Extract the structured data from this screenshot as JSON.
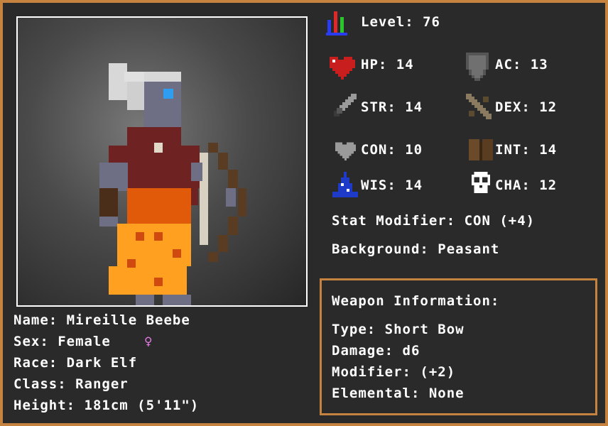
{
  "character": {
    "name_label": "Name: Mireille Beebe",
    "sex_label": "Sex: Female",
    "sex_symbol": "♀",
    "race_label": "Race: Dark Elf",
    "class_label": "Class: Ranger",
    "height_label": "Height: 181cm (5'11\")"
  },
  "stats": {
    "level": "Level: 76",
    "hp": "HP: 14",
    "ac": "AC: 13",
    "str": "STR: 14",
    "dex": "DEX: 12",
    "con": "CON: 10",
    "int": "INT: 14",
    "wis": "WIS: 14",
    "cha": "CHA: 12",
    "stat_modifier": "Stat Modifier: CON (+4)",
    "background": "Background: Peasant"
  },
  "weapon": {
    "title": "Weapon Information:",
    "type": "Type: Short Bow",
    "damage": "Damage: d6",
    "modifier": "Modifier: (+2)",
    "elemental": "Elemental: None"
  },
  "icons": {
    "level": "level-bars-icon",
    "hp": "heart-icon",
    "ac": "shield-icon",
    "str": "sword-icon",
    "dex": "crossed-daggers-icon",
    "con": "grey-heart-icon",
    "int": "book-icon",
    "wis": "wizard-hat-icon",
    "cha": "skull-icon"
  },
  "colors": {
    "border": "#c6823f",
    "background": "#2a2a2a",
    "text": "#ffffff",
    "female_symbol": "#e87ce8"
  }
}
